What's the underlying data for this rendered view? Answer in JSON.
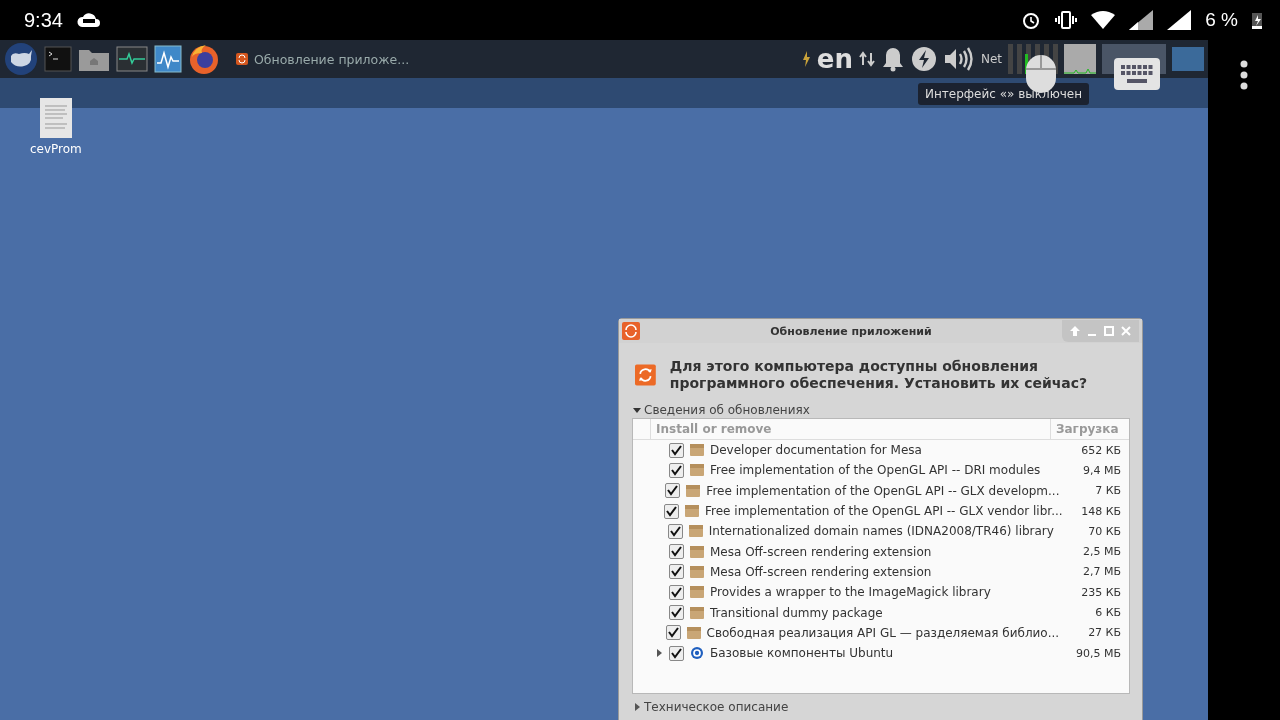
{
  "status_bar": {
    "time": "9:34",
    "battery": "6 %"
  },
  "taskbar": {
    "task_title": "Обновление приложе...",
    "language": "en",
    "net_label": "Net"
  },
  "tooltip": {
    "text": "Интерфейс «» выключен"
  },
  "desktop_icons": [
    {
      "label": "cevProm"
    }
  ],
  "dialog": {
    "title": "Обновление приложений",
    "question": "Для этого компьютера доступны обновления программного обеспечения. Установить их сейчас?",
    "details_expander": {
      "label": "Сведения об обновлениях",
      "expanded": true
    },
    "table": {
      "columns": [
        "Install or remove",
        "Загрузка"
      ],
      "rows": [
        {
          "kind": "package",
          "checked": true,
          "name": "Developer documentation for Mesa",
          "size": "652 КБ"
        },
        {
          "kind": "package",
          "checked": true,
          "name": "Free implementation of the OpenGL API -- DRI modules",
          "size": "9,4 МБ"
        },
        {
          "kind": "package",
          "checked": true,
          "name": "Free implementation of the OpenGL API -- GLX developm...",
          "size": "7 КБ"
        },
        {
          "kind": "package",
          "checked": true,
          "name": "Free implementation of the OpenGL API -- GLX vendor libr...",
          "size": "148 КБ"
        },
        {
          "kind": "package",
          "checked": true,
          "name": "Internationalized domain names (IDNA2008/TR46) library",
          "size": "70 КБ"
        },
        {
          "kind": "package",
          "checked": true,
          "name": "Mesa Off-screen rendering extension",
          "size": "2,5 МБ"
        },
        {
          "kind": "package",
          "checked": true,
          "name": "Mesa Off-screen rendering extension",
          "size": "2,7 МБ"
        },
        {
          "kind": "package",
          "checked": true,
          "name": "Provides a wrapper to the ImageMagick library",
          "size": "235 КБ"
        },
        {
          "kind": "package",
          "checked": true,
          "name": "Transitional dummy package",
          "size": "6 КБ"
        },
        {
          "kind": "package",
          "checked": true,
          "name": "Свободная реализация API GL — разделяемая библио...",
          "size": "27 КБ"
        },
        {
          "kind": "group",
          "checked": true,
          "name": "Базовые компоненты Ubuntu",
          "size": "90,5 МБ"
        }
      ]
    },
    "tech_expander": {
      "label": "Техническое описание",
      "expanded": false
    }
  }
}
